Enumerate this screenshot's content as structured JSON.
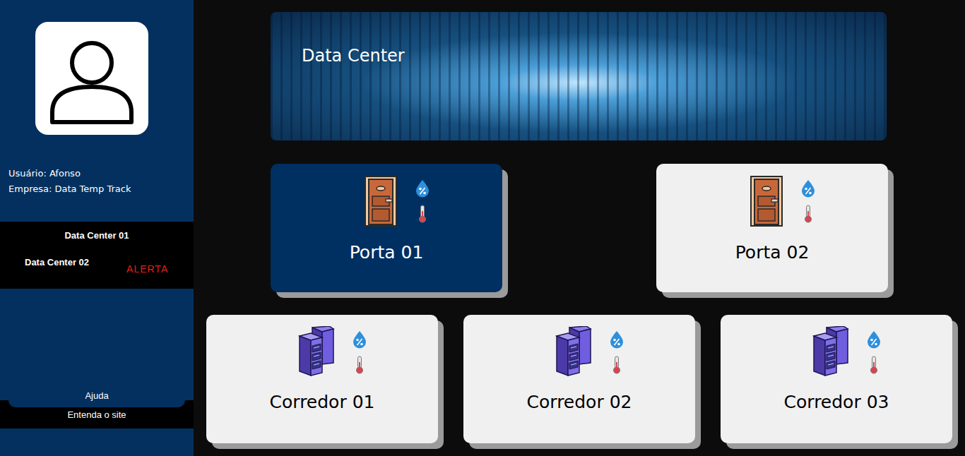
{
  "sidebar": {
    "user": "Usuário: Afonso",
    "company": "Empresa: Data Temp Track",
    "datacenters": [
      {
        "label": "Data Center 01",
        "alert": false,
        "alert_text": ""
      },
      {
        "label": "Data Center 02",
        "alert": true,
        "alert_text": "ALERTA"
      }
    ],
    "help": {
      "label": "Ajuda",
      "subtitle": "Entenda o site"
    }
  },
  "banner": {
    "title": "Data Center"
  },
  "doors": [
    {
      "label": "Porta 01",
      "selected": true
    },
    {
      "label": "Porta 02",
      "selected": false
    }
  ],
  "corridors": [
    {
      "label": "Corredor 01",
      "selected": false
    },
    {
      "label": "Corredor 02",
      "selected": false
    },
    {
      "label": "Corredor 03",
      "selected": false
    }
  ]
}
